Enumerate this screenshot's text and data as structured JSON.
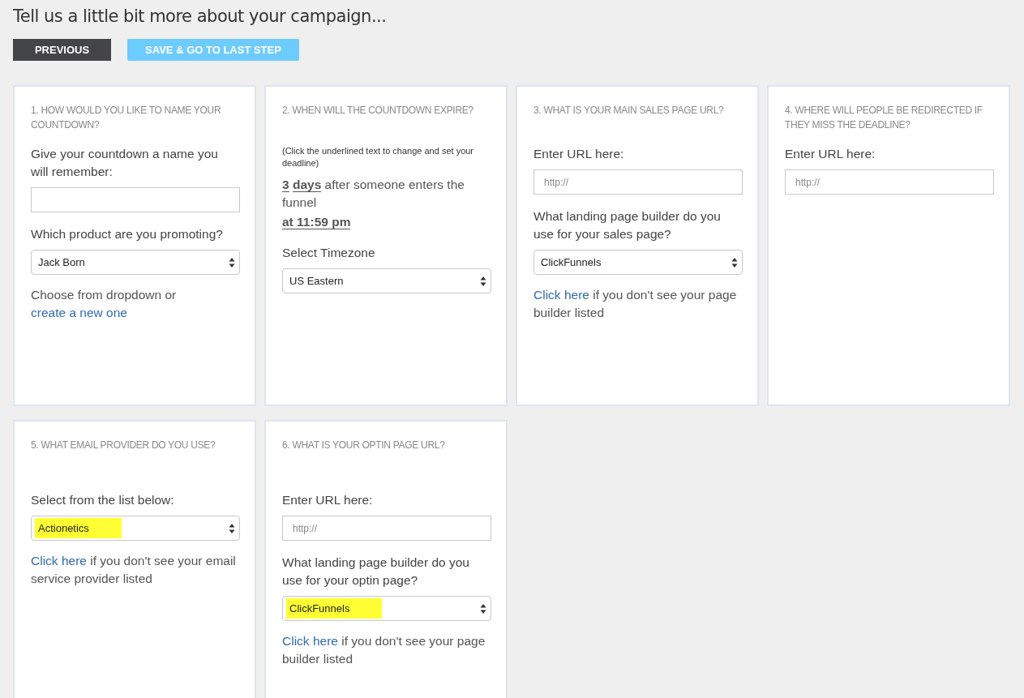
{
  "title": "Tell us a little bit more about your campaign...",
  "buttons": [
    {
      "label": "PREVIOUS",
      "kind": "dark"
    },
    {
      "label": "SAVE & GO TO LAST STEP",
      "kind": "primary"
    }
  ],
  "cards": [
    {
      "heading": "1. HOW WOULD YOU LIKE TO NAME YOUR COUNTDOWN?",
      "blocks": [
        {
          "kind": "label",
          "text": "Give your countdown a name you will remember:"
        },
        {
          "kind": "input"
        },
        {
          "kind": "label",
          "text": "Which product are you promoting?"
        },
        {
          "kind": "select",
          "value": "Jack Born",
          "highlighted": false
        },
        {
          "kind": "help",
          "parts": [
            {
              "text": "Choose from dropdown or",
              "link": false
            },
            {
              "text": "create a new one",
              "link": true
            }
          ]
        }
      ]
    },
    {
      "heading": "2. WHEN WILL THE COUNTDOWN EXPIRE?",
      "blocks": [
        {
          "kind": "note",
          "text": "(Click the underlined text to change and set your deadline)"
        },
        {
          "kind": "deadline",
          "parts": [
            {
              "text": "3",
              "underlined": true
            },
            {
              "text": "days",
              "underlined": true
            },
            {
              "text": "after someone enters the funnel",
              "underlined": false
            }
          ]
        },
        {
          "kind": "deadline",
          "parts": [
            {
              "text": "at 11:59 pm",
              "underlined": true
            }
          ]
        },
        {
          "kind": "label",
          "text": "Select Timezone"
        },
        {
          "kind": "select",
          "value": "US Eastern",
          "highlighted": false
        }
      ]
    },
    {
      "heading": "3. WHAT IS YOUR MAIN SALES PAGE URL?",
      "blocks": [
        {
          "kind": "label",
          "text": "Enter URL here:"
        },
        {
          "kind": "input",
          "placeholder": "http://"
        },
        {
          "kind": "label",
          "text": "What landing page builder do you use for your sales page?"
        },
        {
          "kind": "select",
          "value": "ClickFunnels",
          "highlighted": false
        },
        {
          "kind": "help",
          "parts": [
            {
              "text": "Click here",
              "link": true
            },
            {
              "text": "if you don't see your page builder listed",
              "link": false
            }
          ]
        }
      ]
    },
    {
      "heading": "4. WHERE WILL PEOPLE BE REDIRECTED IF THEY MISS THE DEADLINE?",
      "blocks": [
        {
          "kind": "label",
          "text": "Enter URL here:"
        },
        {
          "kind": "input",
          "placeholder": "http://"
        }
      ]
    },
    {
      "heading": "5. WHAT EMAIL PROVIDER DO YOU USE?",
      "blocks": [
        {
          "kind": "spacer"
        },
        {
          "kind": "label",
          "text": "Select from the list below:"
        },
        {
          "kind": "select",
          "value": "Actionetics",
          "highlighted": true
        },
        {
          "kind": "help",
          "parts": [
            {
              "text": "Click here",
              "link": true
            },
            {
              "text": "if you don't see your email service provider listed",
              "link": false
            }
          ]
        }
      ]
    },
    {
      "heading": "6. WHAT IS YOUR OPTIN PAGE URL?",
      "blocks": [
        {
          "kind": "spacer"
        },
        {
          "kind": "label",
          "text": "Enter URL here:"
        },
        {
          "kind": "input",
          "placeholder": "http://"
        },
        {
          "kind": "label",
          "text": "What landing page builder do you use for your optin page?"
        },
        {
          "kind": "select",
          "value": "ClickFunnels",
          "highlighted": true
        },
        {
          "kind": "help",
          "parts": [
            {
              "text": "Click here",
              "link": true
            },
            {
              "text": "if you don't see your page builder listed",
              "link": false
            }
          ]
        }
      ]
    }
  ]
}
